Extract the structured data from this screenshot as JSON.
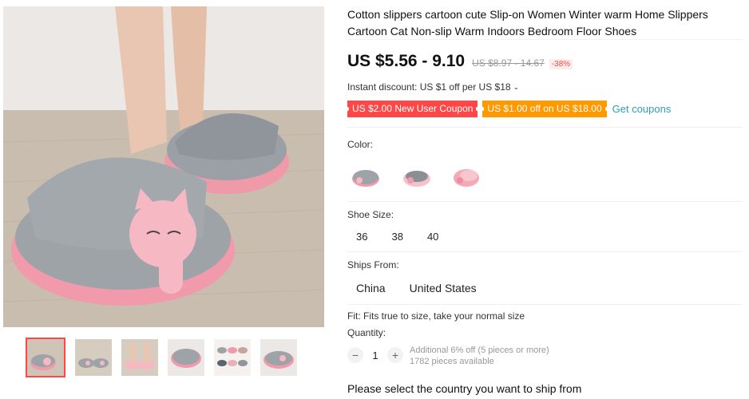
{
  "product": {
    "title": "Cotton slippers cartoon cute Slip-on Women Winter warm Home Slippers Cartoon Cat Non-slip Warm Indoors Bedroom Floor Shoes",
    "price": "US $5.56 - 9.10",
    "original_price": "US $8.97 - 14.67",
    "discount_pct": "-38%"
  },
  "promo": {
    "instant_discount": "Instant discount: US $1 off per US $18",
    "coupon_new_user": "US $2.00 New User Coupon",
    "coupon_off": "US $1.00 off on US $18.00",
    "get_coupons": "Get coupons"
  },
  "options": {
    "color_label": "Color:",
    "colors": [
      "grey-pink",
      "pink-grey",
      "pink"
    ],
    "size_label": "Shoe Size:",
    "sizes": [
      "36",
      "38",
      "40"
    ],
    "ships_label": "Ships From:",
    "ships_from": [
      "China",
      "United States"
    ]
  },
  "fit": "Fit: Fits true to size, take your normal size",
  "quantity": {
    "label": "Quantity:",
    "minus": "−",
    "value": "1",
    "plus": "+",
    "additional": "Additional 6% off (5 pieces or more)",
    "available": "1782 pieces available"
  },
  "ship_message": "Please select the country you want to ship from",
  "colors": {
    "accent_red": "#ff4747",
    "accent_orange": "#ff9900",
    "link_blue": "#2e9cc3"
  }
}
